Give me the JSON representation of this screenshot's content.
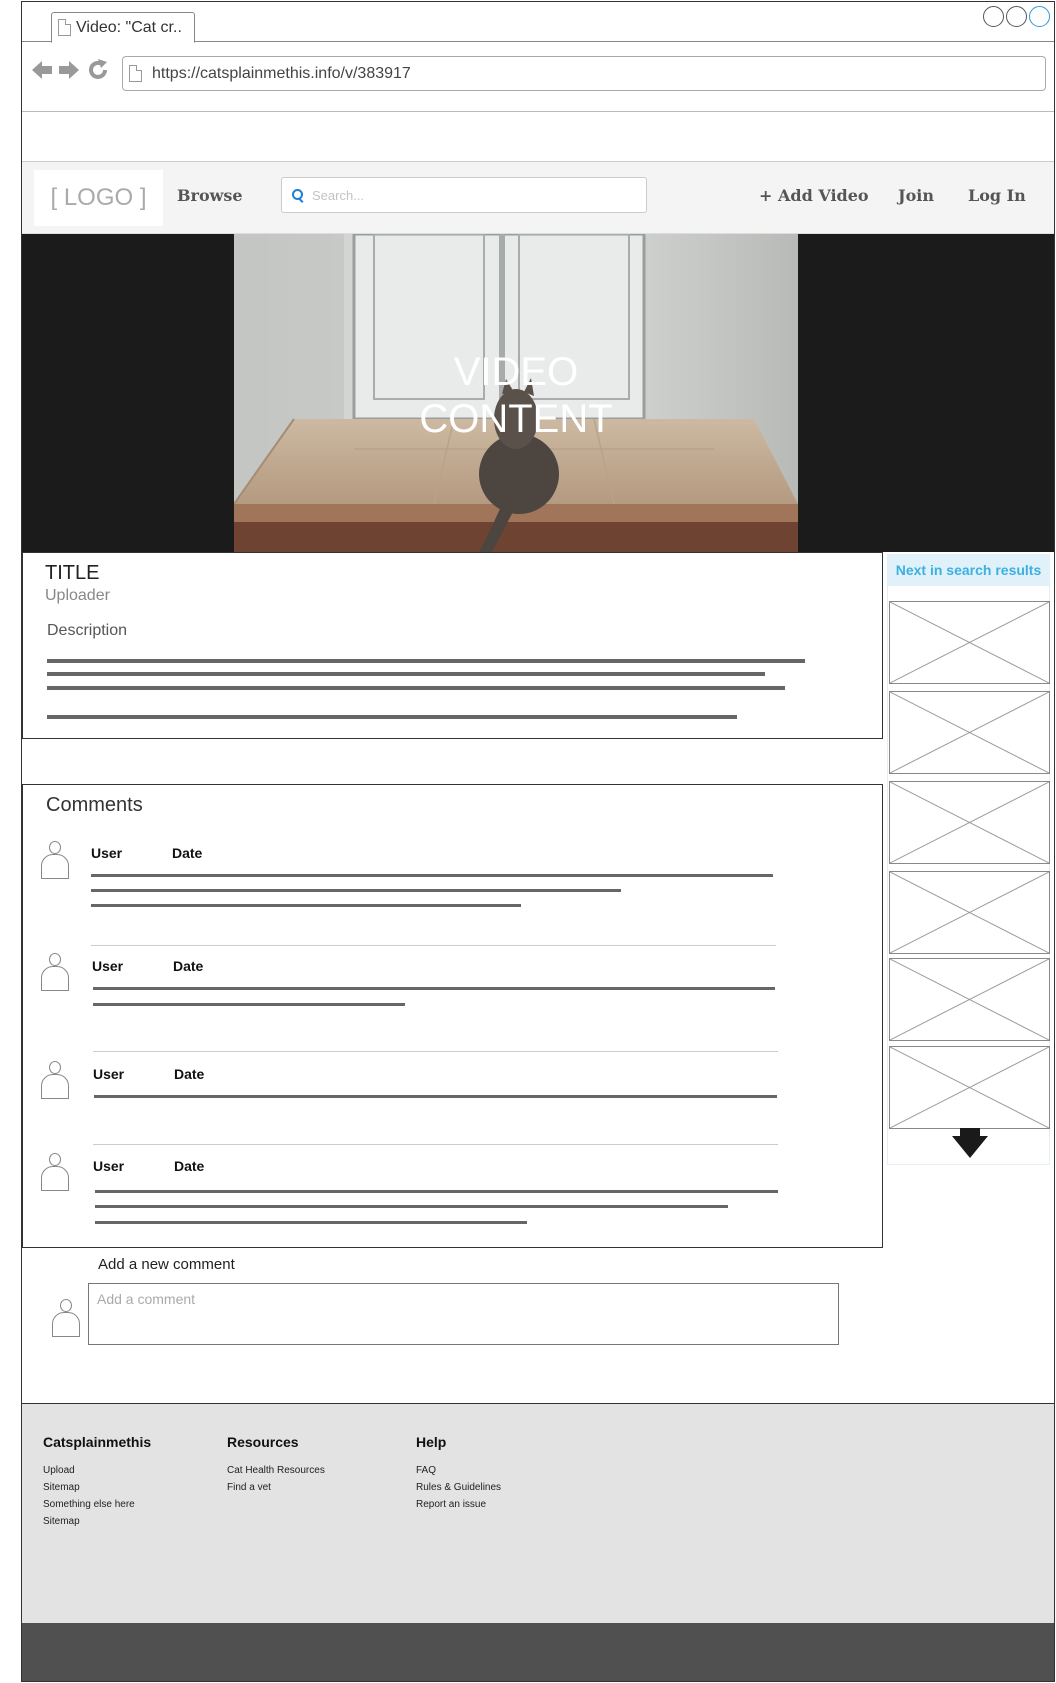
{
  "browser": {
    "tab_title": "Video: \"Cat cr..",
    "url": "https://catsplainmethis.info/v/383917"
  },
  "header": {
    "logo": "[ LOGO ]",
    "browse": "Browse",
    "search_placeholder": "Search...",
    "add_video": "+ Add Video",
    "join": "Join",
    "login": "Log In"
  },
  "video": {
    "overlay_line1": "VIDEO",
    "overlay_line2": "CONTENT"
  },
  "info": {
    "title": "TITLE",
    "uploader": "Uploader",
    "description_label": "Description"
  },
  "comments": {
    "heading": "Comments",
    "items": [
      {
        "user": "User",
        "date": "Date"
      },
      {
        "user": "User",
        "date": "Date"
      },
      {
        "user": "User",
        "date": "Date"
      },
      {
        "user": "User",
        "date": "Date"
      }
    ]
  },
  "add_comment": {
    "label": "Add a new comment",
    "placeholder": "Add a comment"
  },
  "sidebar": {
    "heading": "Next in search results"
  },
  "footer": {
    "columns": [
      {
        "heading": "Catsplainmethis",
        "links": [
          "Upload",
          "Sitemap",
          "Something else here",
          "Sitemap"
        ]
      },
      {
        "heading": "Resources",
        "links": [
          "Cat Health Resources",
          "Find a vet"
        ]
      },
      {
        "heading": "Help",
        "links": [
          "FAQ",
          "Rules & Guidelines",
          "Report an issue"
        ]
      }
    ]
  }
}
